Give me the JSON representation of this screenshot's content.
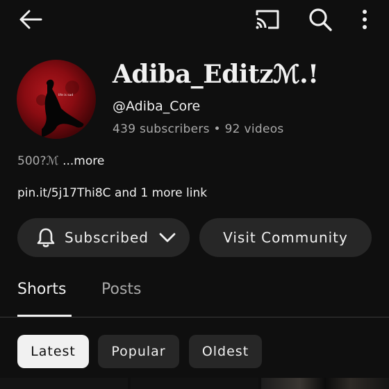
{
  "header": {
    "back_icon": "arrow-left-icon",
    "cast_icon": "cast-icon",
    "search_icon": "search-icon",
    "more_icon": "more-vertical-icon"
  },
  "channel": {
    "name": "Adiba_Editzℳ.!",
    "handle": "@Adiba_Core",
    "subscribers": "439 subscribers",
    "separator": "•",
    "videos": "92 videos",
    "description": "500?ℳ",
    "description_more": "...more",
    "link_url": "pin.it/5j17Thi8C",
    "link_more": " and 1 more link",
    "avatar_text": "life is sad"
  },
  "actions": {
    "subscribe_label": "Subscribed",
    "community_label": "Visit Community"
  },
  "tabs": [
    {
      "label": "Shorts",
      "active": true
    },
    {
      "label": "Posts",
      "active": false
    }
  ],
  "filters": [
    {
      "label": "Latest",
      "active": true
    },
    {
      "label": "Popular",
      "active": false
    },
    {
      "label": "Oldest",
      "active": false
    }
  ],
  "colors": {
    "background": "#0f0f0f",
    "surface": "#272727",
    "text_primary": "#f1f1f1",
    "text_secondary": "#aaaaaa",
    "avatar_red": "#b0181e"
  }
}
